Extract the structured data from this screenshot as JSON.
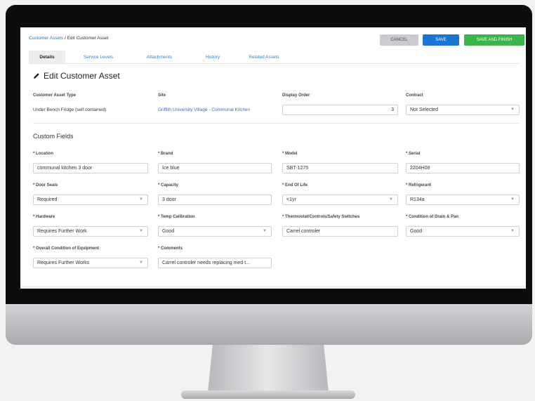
{
  "breadcrumb": {
    "parent": "Customer Assets",
    "separator": " / ",
    "current": "Edit Customer Asset"
  },
  "buttons": {
    "cancel": "CANCEL",
    "save": "SAVE",
    "save_finish": "SAVE AND FINISH"
  },
  "tabs": [
    {
      "label": "Details",
      "active": true
    },
    {
      "label": "Service Levels"
    },
    {
      "label": "Attachments"
    },
    {
      "label": "History"
    },
    {
      "label": "Related Assets"
    }
  ],
  "form": {
    "title": "Edit Customer Asset",
    "summary": [
      {
        "label": "Customer Asset Type",
        "value": "Under Bench Fridge (self contained)"
      },
      {
        "label": "Site",
        "value": "Griffith University Village - Communal Kitchen"
      },
      {
        "label": "Display Order",
        "value": "3"
      },
      {
        "label": "Contract",
        "value": "Not Selected"
      }
    ],
    "custom_fields_title": "Custom Fields",
    "fields": [
      {
        "label": "* Location",
        "value": "communal kitchen 3 door"
      },
      {
        "label": "* Brand",
        "value": "Ice blue"
      },
      {
        "label": "* Model",
        "value": "SBT-1275"
      },
      {
        "label": "* Serial",
        "value": "2204H08"
      },
      {
        "label": "* Door Seals",
        "value": "Required"
      },
      {
        "label": "* Capacity",
        "value": "3 door"
      },
      {
        "label": "* End Of Life",
        "value": "<1yr"
      },
      {
        "label": "* Refrigerant",
        "value": "R134a"
      },
      {
        "label": "* Hardware",
        "value": "Requires Further Work"
      },
      {
        "label": "* Temp Calibration",
        "value": "Good"
      },
      {
        "label": "* Thermostat/Controls/Safety Switches",
        "value": "Carrel controler"
      },
      {
        "label": "* Condition of Drain & Pan",
        "value": "Good"
      },
      {
        "label": "* Overall Condition of Equipment",
        "value": "Requires Further Works"
      },
      {
        "label": "* Comments",
        "value": "Carrel controler needs replacing med t..."
      }
    ]
  },
  "icons": {
    "edit": "pencil-icon",
    "dropdown": "chevron-down-icon"
  },
  "colors": {
    "primary": "#1676d2",
    "success": "#3bb54a",
    "link": "#2a73c8"
  }
}
